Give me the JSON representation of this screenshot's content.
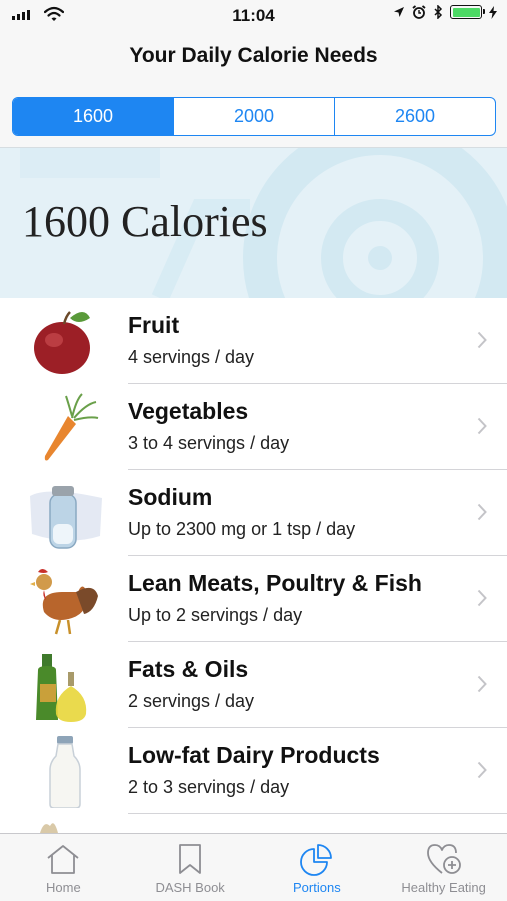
{
  "status_bar": {
    "time": "11:04"
  },
  "nav": {
    "title": "Your Daily Calorie Needs"
  },
  "segments": [
    {
      "label": "1600",
      "selected": true
    },
    {
      "label": "2000",
      "selected": false
    },
    {
      "label": "2600",
      "selected": false
    }
  ],
  "banner": {
    "title": "1600 Calories"
  },
  "food_groups": [
    {
      "name": "Fruit",
      "servings": "4 servings / day",
      "icon": "apple-icon"
    },
    {
      "name": "Vegetables",
      "servings": "3 to 4 servings / day",
      "icon": "carrot-icon"
    },
    {
      "name": "Sodium",
      "servings": "Up to 2300 mg or 1 tsp / day",
      "icon": "salt-shaker-icon"
    },
    {
      "name": "Lean Meats, Poultry & Fish",
      "servings": "Up to 2 servings / day",
      "icon": "rooster-icon"
    },
    {
      "name": "Fats & Oils",
      "servings": "2 servings / day",
      "icon": "oil-bottles-icon"
    },
    {
      "name": "Low-fat Dairy Products",
      "servings": "2 to 3 servings / day",
      "icon": "milk-bottle-icon"
    }
  ],
  "tab_bar": [
    {
      "label": "Home",
      "icon": "home-icon",
      "active": false
    },
    {
      "label": "DASH Book",
      "icon": "bookmark-icon",
      "active": false
    },
    {
      "label": "Portions",
      "icon": "pie-chart-icon",
      "active": true
    },
    {
      "label": "Healthy Eating",
      "icon": "heart-plus-icon",
      "active": false
    }
  ],
  "colors": {
    "accent": "#1e86f2",
    "banner_bg": "#e4f1f7",
    "battery": "#4cd964",
    "inactive_tab": "#8e8e93"
  }
}
